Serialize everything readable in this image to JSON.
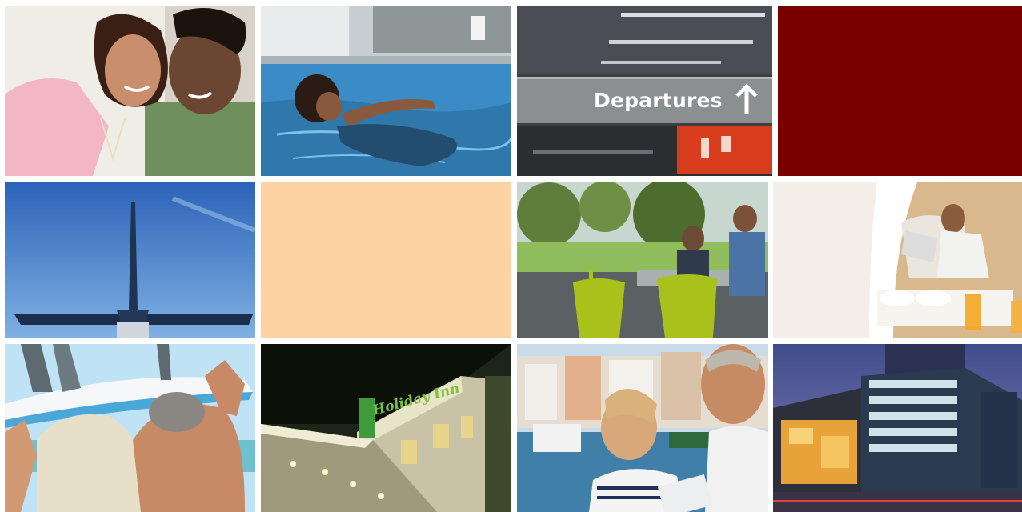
{
  "tiles": [
    {
      "name": "couple-photo-tile",
      "kind": "photo",
      "subject": "smiling-couple"
    },
    {
      "name": "pool-photo-tile",
      "kind": "photo",
      "subject": "woman-swimming-pool"
    },
    {
      "name": "departures-photo-tile",
      "kind": "photo",
      "subject": "airport-departures-sign",
      "sign_text": "Departures"
    },
    {
      "name": "dark-red-color-tile",
      "kind": "color",
      "color": "#7a0000"
    },
    {
      "name": "airplane-tail-photo-tile",
      "kind": "photo",
      "subject": "airplane-tail-sky"
    },
    {
      "name": "peach-color-tile",
      "kind": "color",
      "color": "#fdd3a3"
    },
    {
      "name": "cafe-terrace-photo-tile",
      "kind": "photo",
      "subject": "two-men-cafe-terrace"
    },
    {
      "name": "breakfast-in-bed-photo-tile",
      "kind": "photo",
      "subject": "man-reading-breakfast-tray"
    },
    {
      "name": "beach-surf-photo-tile",
      "kind": "photo",
      "subject": "couple-carrying-surfboard"
    },
    {
      "name": "holiday-inn-photo-tile",
      "kind": "photo",
      "subject": "hotel-night-exterior",
      "sign_text": "Holiday Inn"
    },
    {
      "name": "harbour-couple-photo-tile",
      "kind": "photo",
      "subject": "couple-with-tablet-harbour"
    },
    {
      "name": "glass-hotel-photo-tile",
      "kind": "photo",
      "subject": "glass-building-dusk"
    }
  ],
  "colors": {
    "dark_red": "#7a0000",
    "peach": "#fdd3a3"
  }
}
